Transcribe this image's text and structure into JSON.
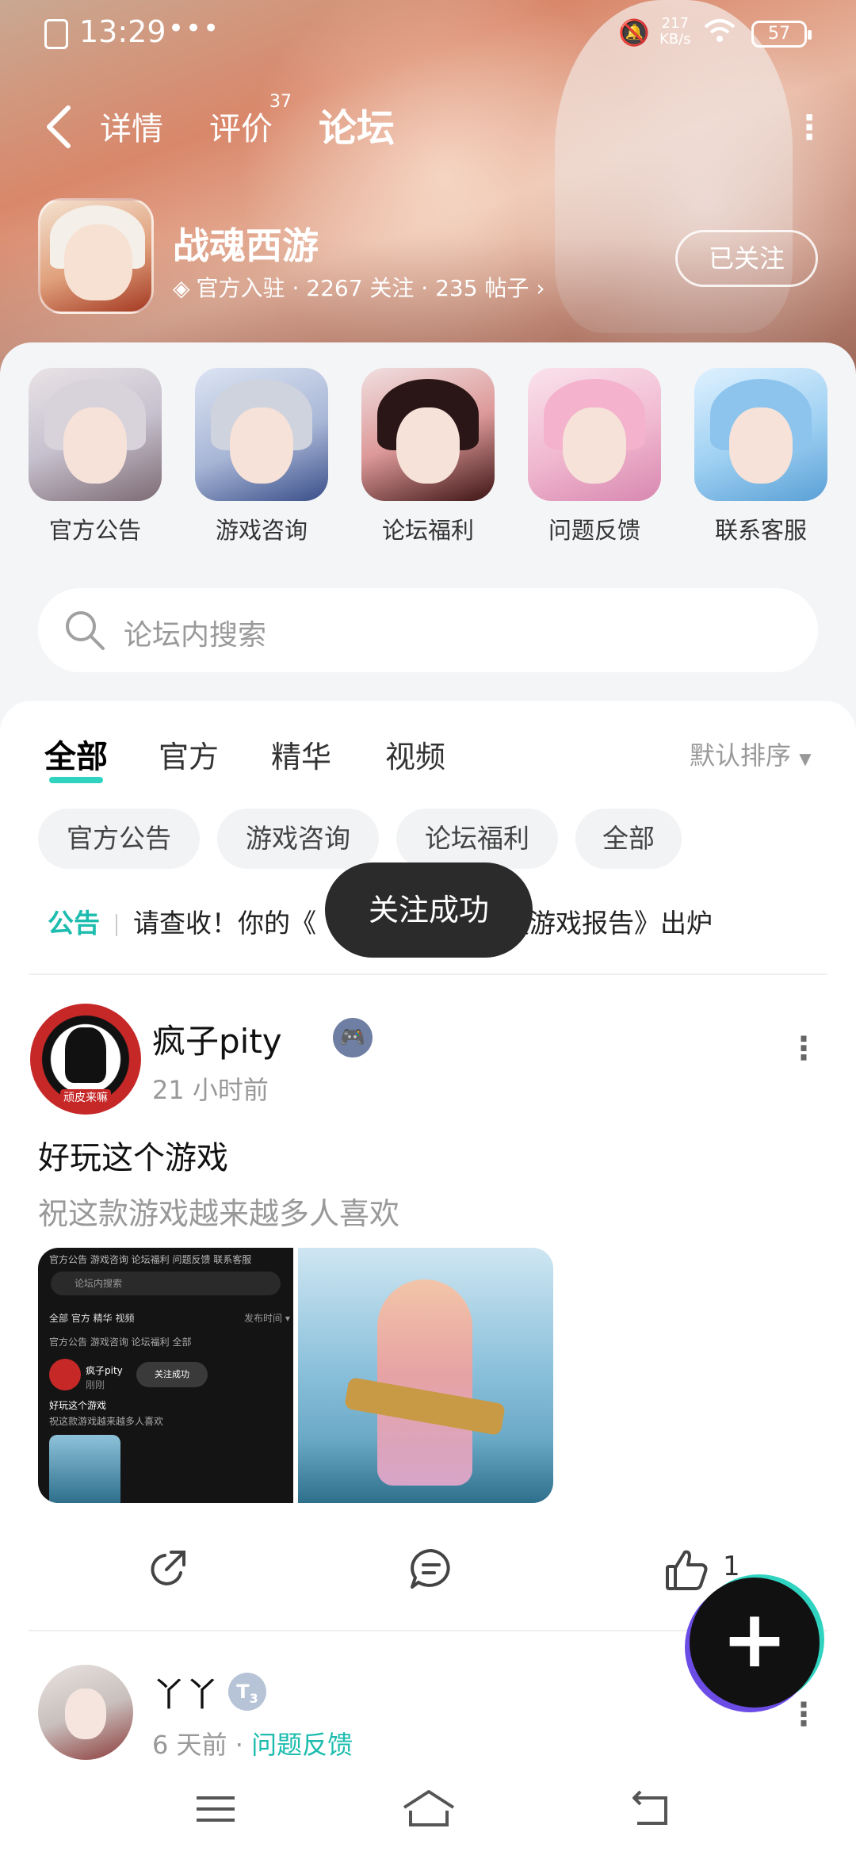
{
  "status_bar": {
    "time": "13:29",
    "dots": "•••",
    "net_speed_value": "217",
    "net_speed_unit": "KB/s",
    "battery": "57"
  },
  "nav": {
    "tabs": [
      {
        "label": "详情"
      },
      {
        "label": "评价",
        "count": "37"
      },
      {
        "label": "论坛"
      }
    ],
    "more_icon": "more-vertical-icon"
  },
  "app": {
    "name": "战魂西游",
    "meta": "官方入驻 · 2267 关注 · 235 帖子",
    "follow_label": "已关注"
  },
  "categories": [
    {
      "label": "官方公告"
    },
    {
      "label": "游戏咨询"
    },
    {
      "label": "论坛福利"
    },
    {
      "label": "问题反馈"
    },
    {
      "label": "联系客服"
    }
  ],
  "search": {
    "placeholder": "论坛内搜索"
  },
  "feed_tabs": {
    "items": [
      "全部",
      "官方",
      "精华",
      "视频"
    ],
    "sort_label": "默认排序"
  },
  "chips": [
    "官方公告",
    "游戏咨询",
    "论坛福利",
    "全部"
  ],
  "notice": {
    "tag": "公告",
    "text_left": "请查收！你的《",
    "text_right": "度游戏报告》出炉"
  },
  "toast": "关注成功",
  "post1": {
    "user": "疯子pity",
    "time": "21 小时前",
    "title": "好玩这个游戏",
    "body": "祝这款游戏越来越多人喜欢",
    "like_count": "1",
    "avatar_badge": "顽皮来嘛",
    "screenshot": {
      "tabs_row": "官方公告 游戏咨询 论坛福利 问题反馈 联系客服",
      "search": "论坛内搜索",
      "feed_tabs": "全部  官方  精华  视频",
      "sort": "发布时间 ▾",
      "chips": "官方公告  游戏咨询  论坛福利  全部",
      "user": "疯子pity",
      "time": "刚刚",
      "toast": "关注成功",
      "title": "好玩这个游戏",
      "body": "祝这款游戏越来越多人喜欢"
    }
  },
  "post2": {
    "user": "丫丫",
    "level": "T",
    "level_num": "3",
    "time": "6 天前",
    "board": "问题反馈"
  },
  "fab_label": "+",
  "colors": {
    "accent": "#2fd3c0",
    "teal_text": "#1cbcae",
    "toast_bg": "#2b2b2b"
  }
}
